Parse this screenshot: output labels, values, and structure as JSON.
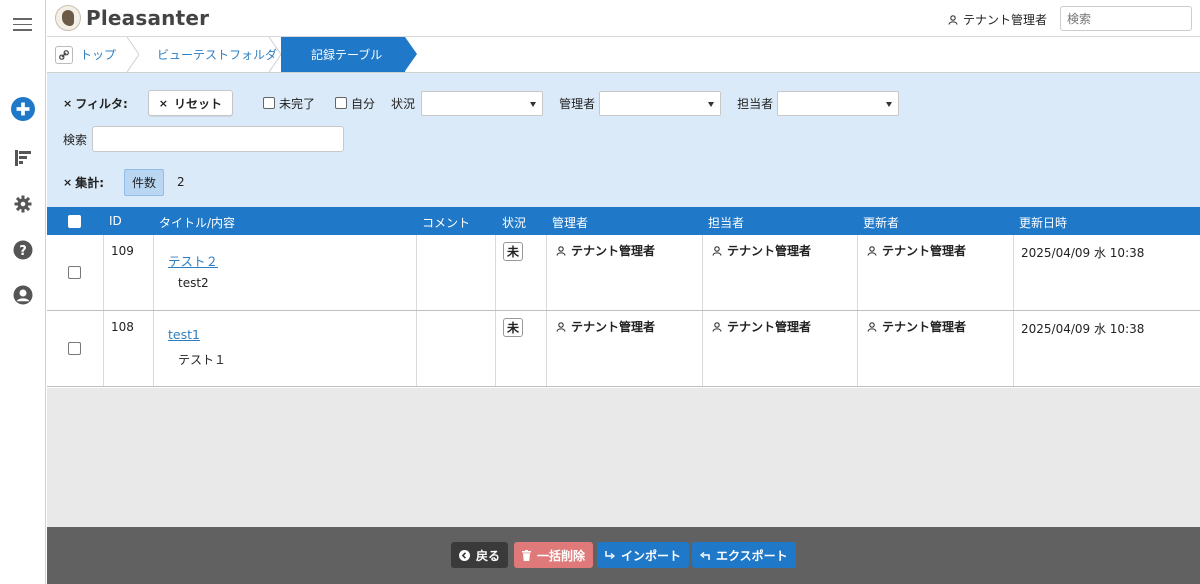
{
  "header": {
    "logo_text": "Pleasanter",
    "user_name": "テナント管理者",
    "search_placeholder": "検索"
  },
  "breadcrumb": {
    "items": [
      "トップ",
      "ビューテストフォルダ",
      "記録テーブル"
    ]
  },
  "filter": {
    "label": "フィルタ:",
    "reset_label": "リセット",
    "incomplete_label": "未完了",
    "mine_label": "自分",
    "status_label": "状況",
    "manager_label": "管理者",
    "owner_label": "担当者",
    "search_label": "検索",
    "aggregate_label": "集計:",
    "count_label": "件数",
    "count_value": "2"
  },
  "table": {
    "columns": [
      "ID",
      "タイトル/内容",
      "コメント",
      "状況",
      "管理者",
      "担当者",
      "更新者",
      "更新日時"
    ],
    "rows": [
      {
        "id": "109",
        "title": "テスト２",
        "body": "test2",
        "status": "未",
        "manager": "テナント管理者",
        "owner": "テナント管理者",
        "updater": "テナント管理者",
        "updated": "2025/04/09 水 10:38"
      },
      {
        "id": "108",
        "title": "test1",
        "body": "テスト１",
        "status": "未",
        "manager": "テナント管理者",
        "owner": "テナント管理者",
        "updater": "テナント管理者",
        "updated": "2025/04/09 水 10:38"
      }
    ]
  },
  "footer": {
    "back_label": "戻る",
    "bulk_delete_label": "一括削除",
    "import_label": "インポート",
    "export_label": "エクスポート"
  },
  "colors": {
    "accent": "#1f78c8",
    "filter_bg": "#dbeaf8",
    "footer_bg": "#616161",
    "delete": "#e07a7a"
  }
}
